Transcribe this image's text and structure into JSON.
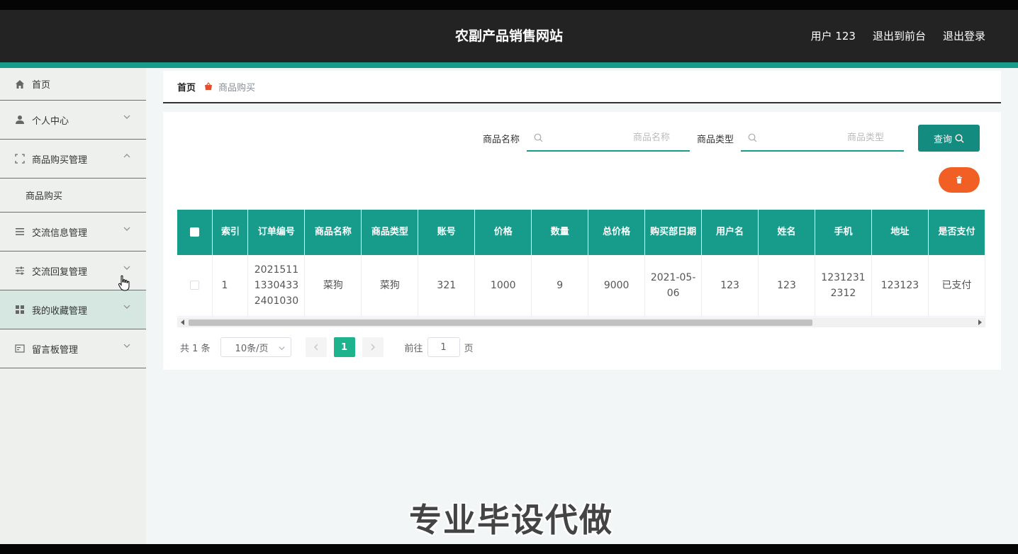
{
  "header": {
    "title": "农副产品销售网站",
    "user": "用户 123",
    "to_front": "退出到前台",
    "logout": "退出登录"
  },
  "sidebar": {
    "items": [
      {
        "label": "首页"
      },
      {
        "label": "个人中心"
      },
      {
        "label": "商品购买管理"
      },
      {
        "label": "商品购买"
      },
      {
        "label": "交流信息管理"
      },
      {
        "label": "交流回复管理"
      },
      {
        "label": "我的收藏管理"
      },
      {
        "label": "留言板管理"
      }
    ]
  },
  "breadcrumb": {
    "home": "首页",
    "current": "商品购买"
  },
  "search": {
    "name_label": "商品名称",
    "name_placeholder": "商品名称",
    "type_label": "商品类型",
    "type_placeholder": "商品类型",
    "query_label": "查询"
  },
  "table": {
    "headers": [
      "索引",
      "订单编号",
      "商品名称",
      "商品类型",
      "账号",
      "价格",
      "数量",
      "总价格",
      "购买部日期",
      "用户名",
      "姓名",
      "手机",
      "地址",
      "是否支付"
    ],
    "rows": [
      [
        "1",
        "202151113304332401030",
        "菜狗",
        "菜狗",
        "321",
        "1000",
        "9",
        "9000",
        "2021-05-06",
        "123",
        "123",
        "12312312312",
        "123123",
        "已支付"
      ]
    ]
  },
  "pagination": {
    "total": "共 1 条",
    "page_size": "10条/页",
    "current_page": "1",
    "goto_label": "前往",
    "goto_value": "1",
    "page_unit": "页"
  },
  "watermark": "专业毕设代做",
  "colors": {
    "header_bg": "#232323",
    "accent": "#179c8b",
    "delete": "#f25f25",
    "active_page": "#1db38d"
  }
}
